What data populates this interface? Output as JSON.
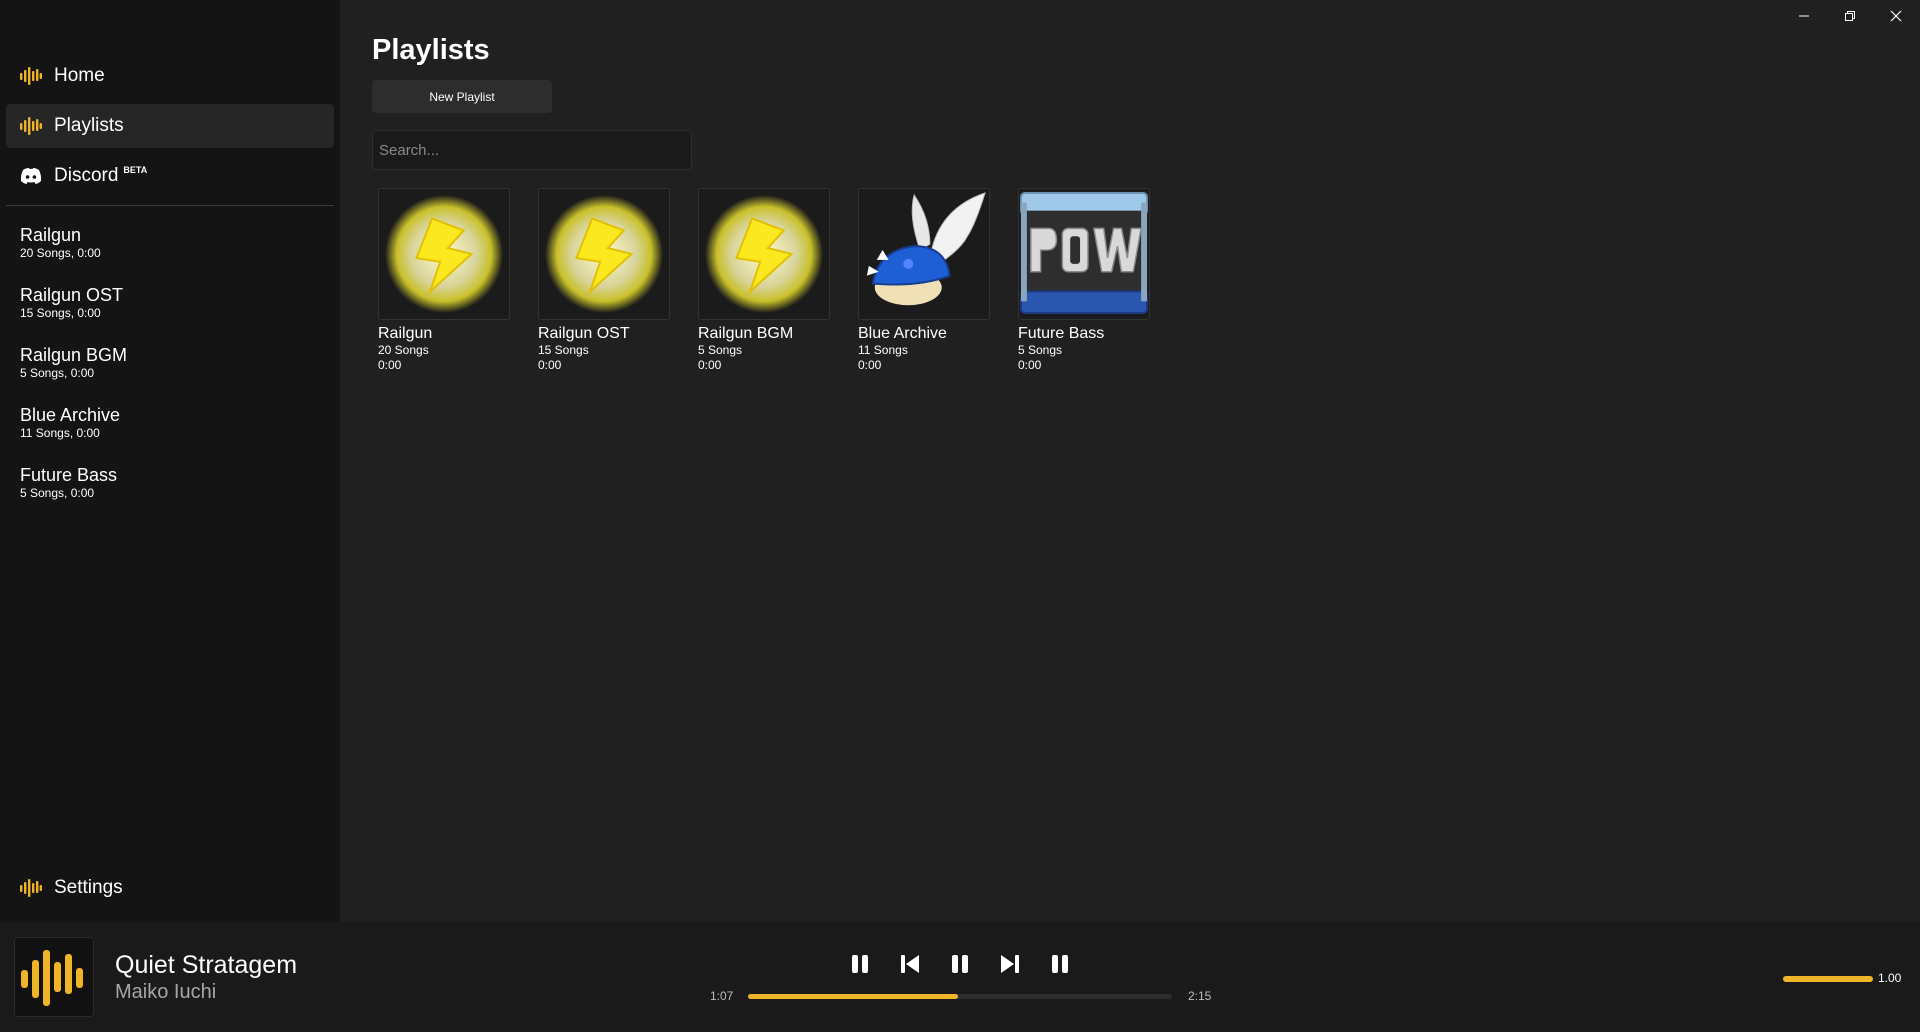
{
  "sidebar": {
    "nav": [
      {
        "label": "Home",
        "icon": "equalizer-icon"
      },
      {
        "label": "Playlists",
        "icon": "equalizer-icon",
        "active": true
      },
      {
        "label": "Discord",
        "badge": "BETA",
        "icon": "discord-icon"
      }
    ],
    "playlists": [
      {
        "name": "Railgun",
        "meta": "20 Songs, 0:00"
      },
      {
        "name": "Railgun OST",
        "meta": "15 Songs, 0:00"
      },
      {
        "name": "Railgun BGM",
        "meta": "5 Songs, 0:00"
      },
      {
        "name": "Blue Archive",
        "meta": "11 Songs, 0:00"
      },
      {
        "name": "Future Bass",
        "meta": "5 Songs, 0:00"
      }
    ],
    "settings_label": "Settings"
  },
  "main": {
    "title": "Playlists",
    "new_playlist_label": "New Playlist",
    "search_placeholder": "Search...",
    "cards": [
      {
        "name": "Railgun",
        "songs": "20 Songs",
        "duration": "0:00",
        "art": "lightning-bolt-icon"
      },
      {
        "name": "Railgun OST",
        "songs": "15 Songs",
        "duration": "0:00",
        "art": "lightning-bolt-icon"
      },
      {
        "name": "Railgun BGM",
        "songs": "5 Songs",
        "duration": "0:00",
        "art": "lightning-bolt-icon"
      },
      {
        "name": "Blue Archive",
        "songs": "11 Songs",
        "duration": "0:00",
        "art": "winged-blue-shell-icon"
      },
      {
        "name": "Future Bass",
        "songs": "5 Songs",
        "duration": "0:00",
        "art": "pow-block-icon"
      }
    ]
  },
  "player": {
    "title": "Quiet Stratagem",
    "artist": "Maiko Iuchi",
    "elapsed": "1:07",
    "total": "2:15",
    "progress_fraction": 0.496,
    "volume_fraction": 1.0,
    "volume_label": "1.00"
  },
  "colors": {
    "accent": "#f0b429",
    "background": "#202020",
    "sidebar": "#141414",
    "player": "#1a1a1a"
  }
}
